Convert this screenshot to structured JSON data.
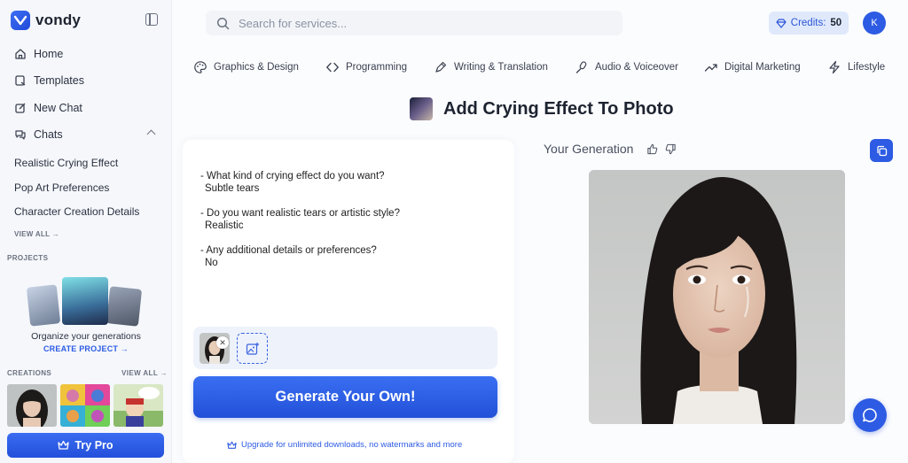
{
  "brand": {
    "name": "vondy"
  },
  "sidebar": {
    "nav": [
      {
        "label": "Home",
        "icon": "home-icon"
      },
      {
        "label": "Templates",
        "icon": "templates-icon"
      },
      {
        "label": "New Chat",
        "icon": "edit-icon"
      },
      {
        "label": "Chats",
        "icon": "chats-icon"
      }
    ],
    "chats": [
      "Realistic Crying Effect",
      "Pop Art Preferences",
      "Character Creation Details"
    ],
    "view_all": "VIEW ALL →",
    "projects_label": "PROJECTS",
    "projects_text": "Organize your generations",
    "create_project": "CREATE PROJECT →",
    "creations_label": "CREATIONS",
    "creations_view_all": "VIEW ALL →",
    "try_pro": "Try Pro"
  },
  "search": {
    "placeholder": "Search for services..."
  },
  "credits": {
    "label": "Credits:",
    "value": "50"
  },
  "user": {
    "initial": "K"
  },
  "categories": [
    {
      "label": "Graphics & Design",
      "icon": "palette-icon"
    },
    {
      "label": "Programming",
      "icon": "code-icon"
    },
    {
      "label": "Writing & Translation",
      "icon": "pen-icon"
    },
    {
      "label": "Audio & Voiceover",
      "icon": "mic-icon"
    },
    {
      "label": "Digital Marketing",
      "icon": "trend-icon"
    },
    {
      "label": "Lifestyle",
      "icon": "bolt-icon"
    }
  ],
  "page": {
    "title": "Add Crying Effect To Photo"
  },
  "qa": [
    {
      "q": "- What kind of crying effect do you want?",
      "a": "Subtle tears"
    },
    {
      "q": "- Do you want realistic tears or artistic style?",
      "a": "Realistic"
    },
    {
      "q": "- Any additional details or preferences?",
      "a": "No"
    }
  ],
  "generate": {
    "label": "Generate Your Own!"
  },
  "upgrade": {
    "text": "Upgrade for unlimited downloads, no watermarks and more"
  },
  "result": {
    "label": "Your Generation"
  },
  "colors": {
    "accent": "#2d5be3",
    "sidebar_bg": "#f5f7fb"
  }
}
